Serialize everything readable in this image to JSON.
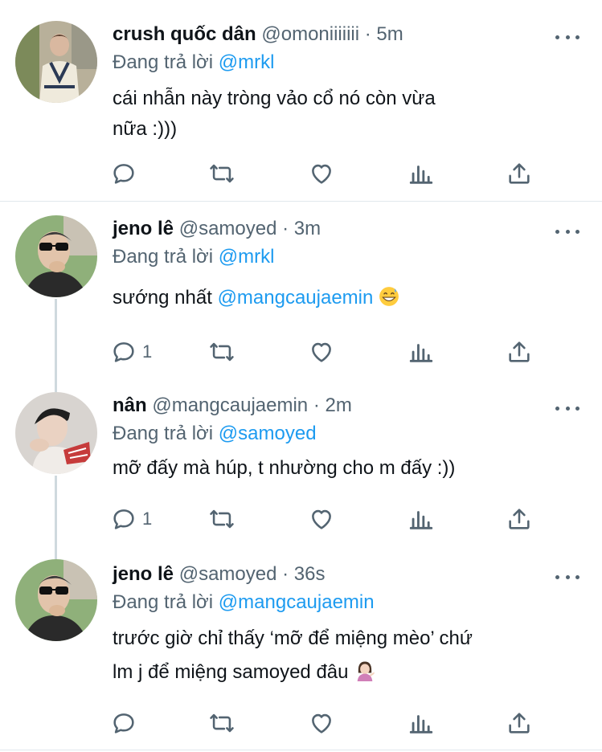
{
  "tweets": [
    {
      "name": "crush quốc dân",
      "handle": "@omoniiiiiii",
      "time": "· 5m",
      "reply_prefix": "Đang trả lời",
      "reply_to": "@mrkl",
      "text_line1": "cái nhẫn này tròng vảo cổ nó còn vừa",
      "text_line2": "nữa :)))",
      "reply_count": ""
    },
    {
      "name": "jeno lê",
      "handle": "@samoyed",
      "time": "· 3m",
      "reply_prefix": "Đang trả lời",
      "reply_to": "@mrkl",
      "text_before": "sướng nhất",
      "text_mention": "@mangcaujaemin",
      "reply_count": "1"
    },
    {
      "name": "nân",
      "handle": "@mangcaujaemin",
      "time": "· 2m",
      "reply_prefix": "Đang trả lời",
      "reply_to": "@samoyed",
      "text_line1": "mỡ đấy mà húp, t nhường cho m đấy :))",
      "reply_count": "1"
    },
    {
      "name": "jeno lê",
      "handle": "@samoyed",
      "time": "· 36s",
      "reply_prefix": "Đang trả lời",
      "reply_to": "@mangcaujaemin",
      "text_line1": "trước giờ chỉ thấy ‘mỡ để miệng mèo’ chứ",
      "text_line2": "lm j để miệng samoyed đâu",
      "reply_count": ""
    }
  ],
  "colors": {
    "accent": "#1d9bf0",
    "muted": "#536471",
    "text": "#0f1419",
    "thread_line": "#cfd9de"
  }
}
